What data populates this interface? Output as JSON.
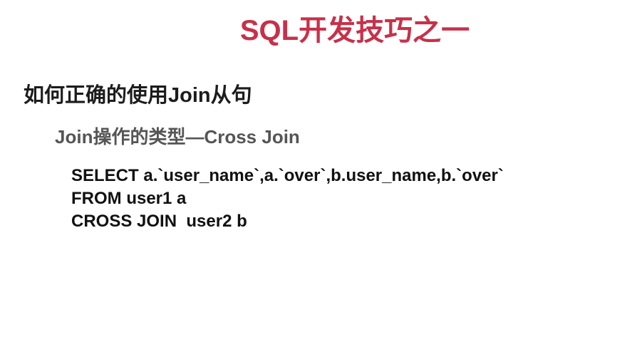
{
  "slide": {
    "title": "SQL开发技巧之一",
    "heading": "如何正确的使用Join从句",
    "subheading": "Join操作的类型—Cross Join",
    "code_lines": [
      "SELECT a.`user_name`,a.`over`,b.user_name,b.`over`",
      "FROM user1 a",
      "CROSS JOIN  user2 b"
    ],
    "colors": {
      "title": "#c8304a",
      "heading": "#1c1c1c",
      "subheading": "#555555",
      "code": "#111111",
      "background": "#ffffff"
    }
  }
}
